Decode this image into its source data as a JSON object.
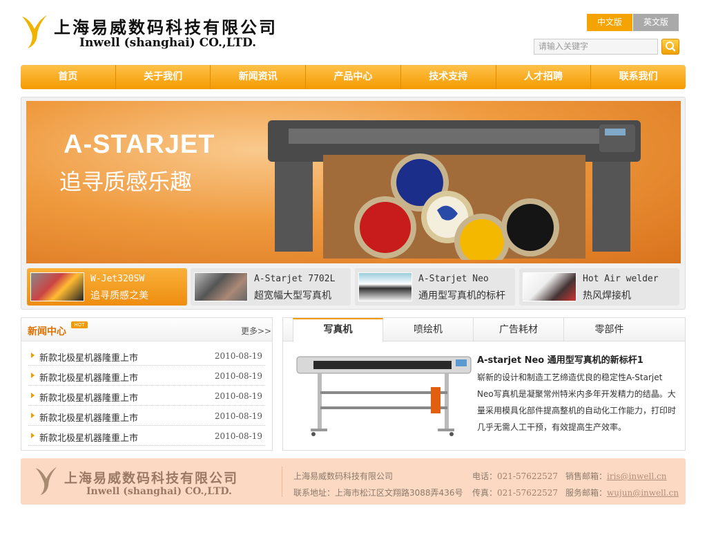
{
  "header": {
    "logo_cn": "上海易威数码科技有限公司",
    "logo_en": "Inwell (shanghai) CO.,LTD.",
    "lang_cn": "中文版",
    "lang_en": "英文版",
    "search_placeholder": "请输入关键字",
    "accent_color": "#f4a300"
  },
  "nav": {
    "items": [
      "首页",
      "关于我们",
      "新闻资讯",
      "产品中心",
      "技术支持",
      "人才招聘",
      "联系我们"
    ]
  },
  "banner": {
    "title": "A-STARJET",
    "subtitle": "追寻质感乐趣",
    "thumbs": [
      {
        "line1": "W-Jet320SW",
        "line2": "追寻质感之美"
      },
      {
        "line1": "A-Starjet 7702L",
        "line2": "超宽幅大型写真机"
      },
      {
        "line1": "A-Starjet Neo",
        "line2": "通用型写真机的标杆"
      },
      {
        "line1": "Hot Air welder",
        "line2": "热风焊接机"
      }
    ]
  },
  "news": {
    "title": "新闻中心",
    "hot_badge": "HOT",
    "more": "更多>>",
    "items": [
      {
        "text": "新款北极星机器隆重上市",
        "date": "2010-08-19"
      },
      {
        "text": "新款北极星机器隆重上市",
        "date": "2010-08-19"
      },
      {
        "text": "新款北极星机器隆重上市",
        "date": "2010-08-19"
      },
      {
        "text": "新款北极星机器隆重上市",
        "date": "2010-08-19"
      },
      {
        "text": "新款北极星机器隆重上市",
        "date": "2010-08-19"
      }
    ]
  },
  "products": {
    "tabs": [
      "写真机",
      "喷绘机",
      "广告耗材",
      "零部件"
    ],
    "title": "A-starjet Neo 通用型写真机的新标杆1",
    "desc": "崭新的设计和制造工艺缔造优良的稳定性A-Starjet Neo写真机是凝聚常州特米内多年开发精力的结晶。大量采用模具化部件提高整机的自动化工作能力，打印时几乎无需人工干预，有效提高生产效率。"
  },
  "footer": {
    "logo_cn": "上海易威数码科技有限公司",
    "logo_en": "Inwell (shanghai) CO.,LTD.",
    "company": "上海易威数码科技有限公司",
    "address_label": "联系地址：",
    "address": "上海市松江区文翔路3088弄436号",
    "tel_label": "电话：",
    "tel": "021-57622527",
    "fax_label": "传真：",
    "fax": "021-57622527",
    "sales_label": "销售邮箱：",
    "sales_email": "iris@inwell.cn",
    "service_label": "服务邮箱：",
    "service_email": "wujun@inwell.cn"
  }
}
